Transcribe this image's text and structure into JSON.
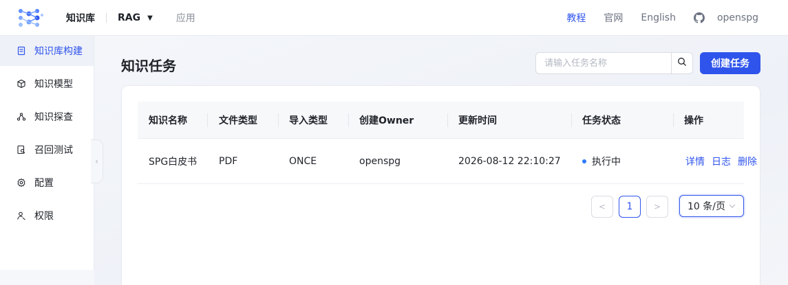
{
  "header": {
    "nav_kb": "知识库",
    "nav_rag": "RAG",
    "nav_app": "应用",
    "nav_tutorial": "教程",
    "nav_site": "官网",
    "nav_lang": "English",
    "nav_user": "openspg"
  },
  "sidebar": {
    "items": [
      {
        "label": "知识库构建",
        "icon": "document-icon",
        "active": true
      },
      {
        "label": "知识模型",
        "icon": "cube-icon"
      },
      {
        "label": "知识探查",
        "icon": "graph-nodes-icon"
      },
      {
        "label": "召回测试",
        "icon": "search-doc-icon"
      },
      {
        "label": "配置",
        "icon": "gear-icon"
      },
      {
        "label": "权限",
        "icon": "user-key-icon"
      }
    ]
  },
  "main": {
    "title": "知识任务",
    "search_placeholder": "请输入任务名称",
    "create_label": "创建任务",
    "table": {
      "columns": [
        "知识名称",
        "文件类型",
        "导入类型",
        "创建Owner",
        "更新时间",
        "任务状态",
        "操作"
      ],
      "rows": [
        {
          "name": "SPG白皮书",
          "file_type": "PDF",
          "import_type": "ONCE",
          "owner": "openspg",
          "updated": "2026-08-12 22:10:27",
          "status": "执行中",
          "actions": [
            "详情",
            "日志",
            "删除"
          ]
        }
      ]
    },
    "pagination": {
      "prev": "<",
      "current": "1",
      "next": ">",
      "page_size": "10 条/页"
    }
  },
  "colors": {
    "accent": "#2f54eb",
    "status_running": "#2f7bff"
  }
}
